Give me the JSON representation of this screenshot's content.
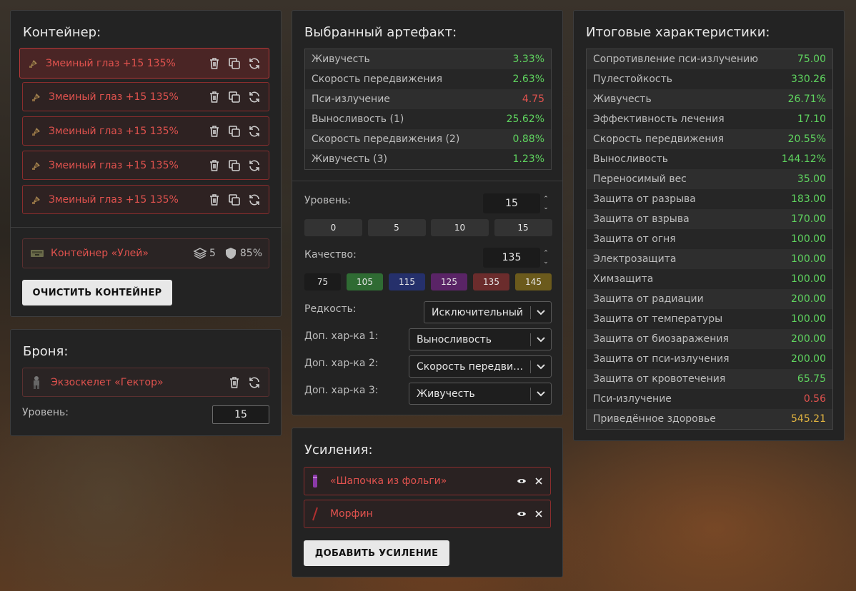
{
  "container": {
    "title": "Контейнер:",
    "items": [
      {
        "name": "Змеиный глаз +15 135%"
      },
      {
        "name": "Змеиный глаз +15 135%"
      },
      {
        "name": "Змеиный глаз +15 135%"
      },
      {
        "name": "Змеиный глаз +15 135%"
      },
      {
        "name": "Змеиный глаз +15 135%"
      }
    ],
    "container_name": "Контейнер «Улей»",
    "slots": "5",
    "protection": "85%",
    "clear_button": "ОЧИСТИТЬ КОНТЕЙНЕР"
  },
  "armor": {
    "title": "Броня:",
    "name": "Экзоскелет «Гектор»",
    "level_label": "Уровень:",
    "level_value": "15"
  },
  "artifact": {
    "title": "Выбранный артефакт:",
    "stats": [
      {
        "label": "Живучесть",
        "value": "3.33%",
        "color": "g"
      },
      {
        "label": "Скорость передвижения",
        "value": "2.63%",
        "color": "g"
      },
      {
        "label": "Пси-излучение",
        "value": "4.75",
        "color": "r"
      },
      {
        "label": "Выносливость (1)",
        "value": "25.62%",
        "color": "g"
      },
      {
        "label": "Скорость передвижения (2)",
        "value": "0.88%",
        "color": "g"
      },
      {
        "label": "Живучесть (3)",
        "value": "1.23%",
        "color": "g"
      }
    ],
    "level_label": "Уровень:",
    "level_value": "15",
    "level_presets": [
      "0",
      "5",
      "10",
      "15"
    ],
    "quality_label": "Качество:",
    "quality_value": "135",
    "quality_presets": [
      {
        "label": "75",
        "color": "#1b1b1b"
      },
      {
        "label": "105",
        "color": "#2f6b33"
      },
      {
        "label": "115",
        "color": "#25306b"
      },
      {
        "label": "125",
        "color": "#5a2466"
      },
      {
        "label": "135",
        "color": "#6b2c2c"
      },
      {
        "label": "145",
        "color": "#6b5a1c"
      }
    ],
    "rarity_label": "Редкость:",
    "rarity_value": "Исключительный",
    "extra1_label": "Доп. хар-ка 1:",
    "extra1_value": "Выносливость",
    "extra2_label": "Доп. хар-ка 2:",
    "extra2_value": "Скорость передвижения",
    "extra3_label": "Доп. хар-ка 3:",
    "extra3_value": "Живучесть"
  },
  "boosts": {
    "title": "Усиления:",
    "items": [
      {
        "name": "«Шапочка из фольги»"
      },
      {
        "name": "Морфин"
      }
    ],
    "add_button": "ДОБАВИТЬ УСИЛЕНИЕ"
  },
  "totals": {
    "title": "Итоговые характеристики:",
    "stats": [
      {
        "label": "Сопротивление пси-излучению",
        "value": "75.00",
        "color": "g"
      },
      {
        "label": "Пулестойкость",
        "value": "330.26",
        "color": "g"
      },
      {
        "label": "Живучесть",
        "value": "26.71%",
        "color": "g"
      },
      {
        "label": "Эффективность лечения",
        "value": "17.10",
        "color": "g"
      },
      {
        "label": "Скорость передвижения",
        "value": "20.55%",
        "color": "g"
      },
      {
        "label": "Выносливость",
        "value": "144.12%",
        "color": "g"
      },
      {
        "label": "Переносимый вес",
        "value": "35.00",
        "color": "g"
      },
      {
        "label": "Защита от разрыва",
        "value": "183.00",
        "color": "g"
      },
      {
        "label": "Защита от взрыва",
        "value": "170.00",
        "color": "g"
      },
      {
        "label": "Защита от огня",
        "value": "100.00",
        "color": "g"
      },
      {
        "label": "Электрозащита",
        "value": "100.00",
        "color": "g"
      },
      {
        "label": "Химзащита",
        "value": "100.00",
        "color": "g"
      },
      {
        "label": "Защита от радиации",
        "value": "200.00",
        "color": "g"
      },
      {
        "label": "Защита от температуры",
        "value": "100.00",
        "color": "g"
      },
      {
        "label": "Защита от биозаражения",
        "value": "200.00",
        "color": "g"
      },
      {
        "label": "Защита от пси-излучения",
        "value": "200.00",
        "color": "g"
      },
      {
        "label": "Защита от кровотечения",
        "value": "65.75",
        "color": "g"
      },
      {
        "label": "Пси-излучение",
        "value": "0.56",
        "color": "r"
      },
      {
        "label": "Приведённое здоровье",
        "value": "545.21",
        "color": "y"
      }
    ]
  }
}
